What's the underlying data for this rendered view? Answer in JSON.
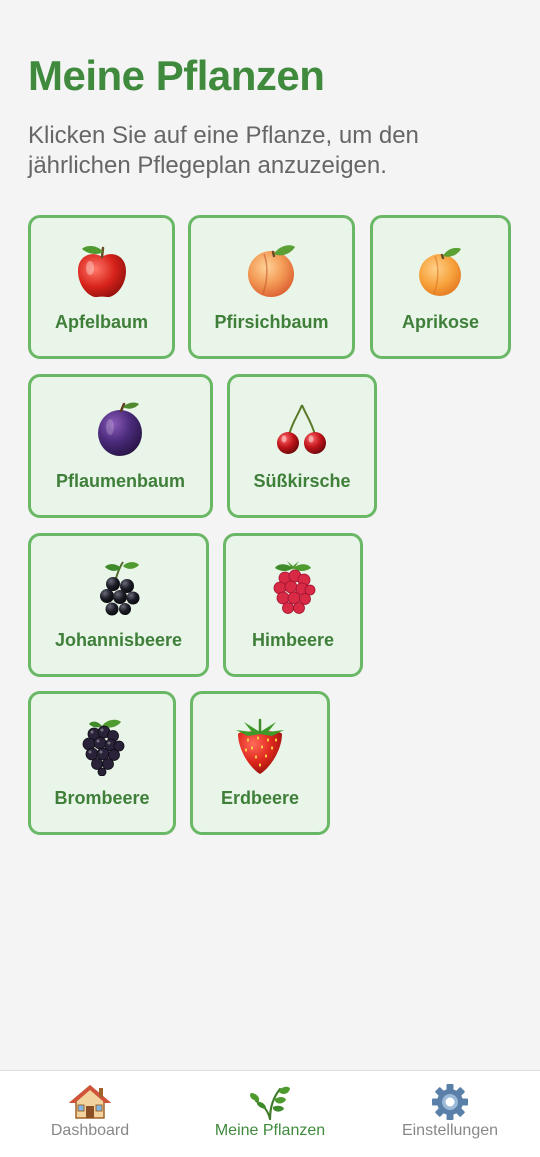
{
  "header": {
    "title": "Meine Pflanzen",
    "subtitle": "Klicken Sie auf eine Pflanze, um den jährlichen Pflegeplan anzuzeigen."
  },
  "plants": [
    {
      "label": "Apfelbaum",
      "icon": "apple-icon"
    },
    {
      "label": "Pfirsichbaum",
      "icon": "peach-icon"
    },
    {
      "label": "Aprikose",
      "icon": "apricot-icon"
    },
    {
      "label": "Pflaumenbaum",
      "icon": "plum-icon"
    },
    {
      "label": "Süßkirsche",
      "icon": "cherry-icon"
    },
    {
      "label": "Johannisbeere",
      "icon": "blackcurrant-icon"
    },
    {
      "label": "Himbeere",
      "icon": "raspberry-icon"
    },
    {
      "label": "Brombeere",
      "icon": "blackberry-icon"
    },
    {
      "label": "Erdbeere",
      "icon": "strawberry-icon"
    }
  ],
  "nav": {
    "items": [
      {
        "label": "Dashboard",
        "icon": "house-icon",
        "active": false
      },
      {
        "label": "Meine Pflanzen",
        "icon": "plant-icon",
        "active": true
      },
      {
        "label": "Einstellungen",
        "icon": "gear-icon",
        "active": false
      }
    ]
  },
  "colors": {
    "accent": "#3f8a3c",
    "tile_background": "#e9f5e8",
    "tile_border": "#6ab866",
    "page_background": "#f4f4f4",
    "inactive_nav": "#888888"
  }
}
